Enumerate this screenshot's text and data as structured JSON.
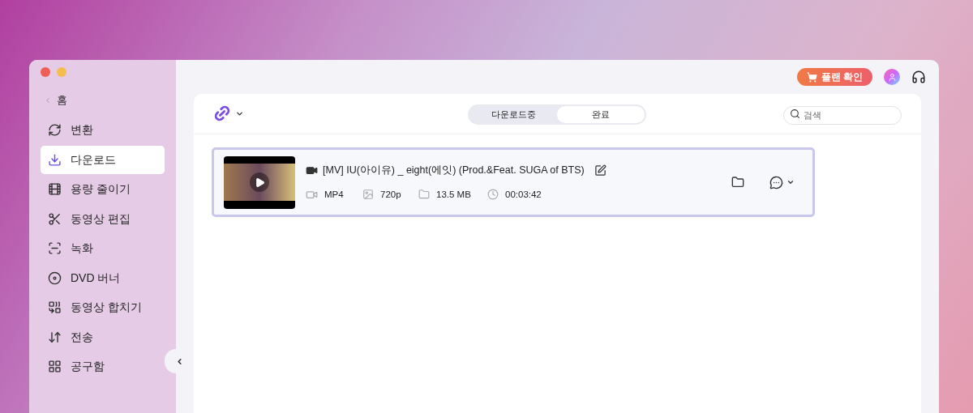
{
  "header": {
    "plan_button": "플랜 확인"
  },
  "sidebar": {
    "back": "홈",
    "items": [
      {
        "label": "변환",
        "selected": false
      },
      {
        "label": "다운로드",
        "selected": true
      },
      {
        "label": "용량 줄이기",
        "selected": false
      },
      {
        "label": "동영상 편집",
        "selected": false
      },
      {
        "label": "녹화",
        "selected": false
      },
      {
        "label": "DVD 버너",
        "selected": false
      },
      {
        "label": "동영상 합치기",
        "selected": false
      },
      {
        "label": "전송",
        "selected": false
      },
      {
        "label": "공구함",
        "selected": false
      }
    ]
  },
  "toolbar": {
    "tabs": [
      {
        "label": "다운로드중",
        "selected": false
      },
      {
        "label": "완료",
        "selected": true
      }
    ],
    "search": {
      "placeholder": "검색"
    }
  },
  "downloads": [
    {
      "title": "[MV] IU(아이유) _ eight(에잇) (Prod.&Feat. SUGA of BTS)",
      "format": "MP4",
      "resolution": "720p",
      "size": "13.5 MB",
      "duration": "00:03:42",
      "selected": true
    }
  ]
}
